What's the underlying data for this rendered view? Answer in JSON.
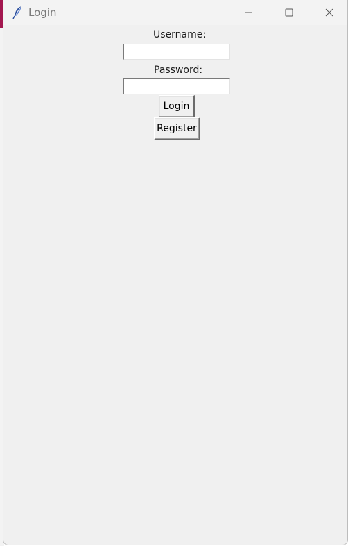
{
  "window": {
    "title": "Login",
    "icon": "feather-icon",
    "controls": [
      "minimize-icon",
      "maximize-icon",
      "close-icon"
    ]
  },
  "form": {
    "username_label": "Username:",
    "username_value": "",
    "password_label": "Password:",
    "password_value": "",
    "login_label": "Login",
    "register_label": "Register"
  },
  "colors": {
    "window_bg": "#f0f0f0",
    "titlebar_bg": "#f3f3f3",
    "title_text": "#7a7a7a",
    "background_accent": "#a3174f"
  }
}
